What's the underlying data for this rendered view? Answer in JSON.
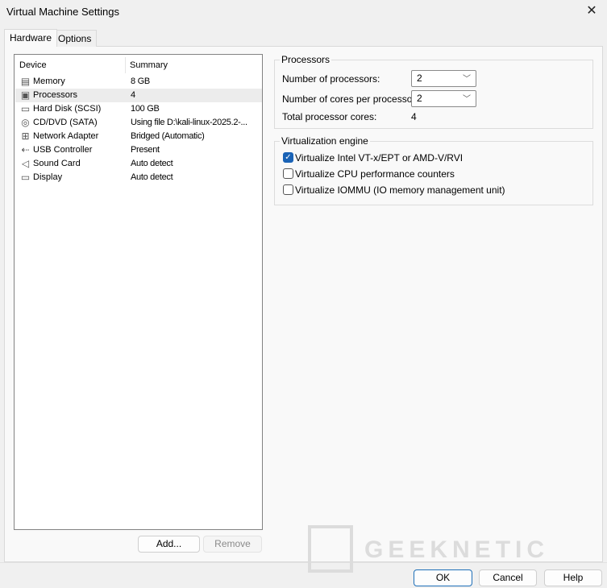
{
  "window": {
    "title": "Virtual Machine Settings"
  },
  "tabs": [
    {
      "label": "Hardware",
      "active": true
    },
    {
      "label": "Options",
      "active": false
    }
  ],
  "device_list": {
    "headers": {
      "device": "Device",
      "summary": "Summary"
    },
    "rows": [
      {
        "icon": "memory-icon",
        "device": "Memory",
        "summary": "8 GB"
      },
      {
        "icon": "processor-icon",
        "device": "Processors",
        "summary": "4",
        "selected": true
      },
      {
        "icon": "hard-disk-icon",
        "device": "Hard Disk (SCSI)",
        "summary": "100 GB"
      },
      {
        "icon": "cd-dvd-icon",
        "device": "CD/DVD (SATA)",
        "summary": "Using file D:\\kali-linux-2025.2-..."
      },
      {
        "icon": "network-adapter-icon",
        "device": "Network Adapter",
        "summary": "Bridged (Automatic)"
      },
      {
        "icon": "usb-icon",
        "device": "USB Controller",
        "summary": "Present"
      },
      {
        "icon": "sound-card-icon",
        "device": "Sound Card",
        "summary": "Auto detect"
      },
      {
        "icon": "display-icon",
        "device": "Display",
        "summary": "Auto detect"
      }
    ],
    "add_label": "Add...",
    "remove_label": "Remove"
  },
  "processors": {
    "group_label": "Processors",
    "num_processors_label": "Number of processors:",
    "num_processors_value": "2",
    "cores_label": "Number of cores per processor:",
    "cores_value": "2",
    "total_label": "Total processor cores:",
    "total_value": "4"
  },
  "virtualization": {
    "group_label": "Virtualization engine",
    "options": [
      {
        "label": "Virtualize Intel VT-x/EPT or AMD-V/RVI",
        "checked": true
      },
      {
        "label": "Virtualize CPU performance counters",
        "checked": false
      },
      {
        "label": "Virtualize IOMMU (IO memory management unit)",
        "checked": false
      }
    ]
  },
  "footer": {
    "ok": "OK",
    "cancel": "Cancel",
    "help": "Help"
  },
  "watermark": "GEEKNETIC",
  "colors": {
    "accent": "#1a63b6",
    "selection": "#ececec"
  }
}
